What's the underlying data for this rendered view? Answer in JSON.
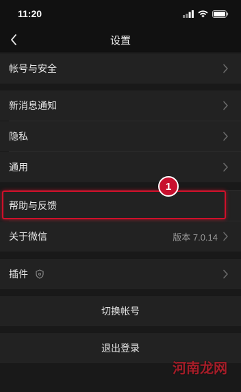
{
  "status": {
    "time": "11:20"
  },
  "nav": {
    "title": "设置"
  },
  "rows": {
    "account_security": "帐号与安全",
    "new_message_notify": "新消息通知",
    "privacy": "隐私",
    "general": "通用",
    "help_feedback": "帮助与反馈",
    "about_wechat": "关于微信",
    "about_version": "版本 7.0.14",
    "plugins": "插件",
    "switch_account": "切换帐号",
    "logout": "退出登录"
  },
  "annotation": {
    "step_number": "1",
    "highlight_color": "#d0102a"
  },
  "watermark": {
    "text": "河南龙网"
  },
  "icons": {
    "back": "chevron-left-icon",
    "chevron": "chevron-right-icon",
    "plugin": "shield-icon",
    "signal": "signal-icon",
    "wifi": "wifi-icon",
    "battery": "battery-icon"
  }
}
